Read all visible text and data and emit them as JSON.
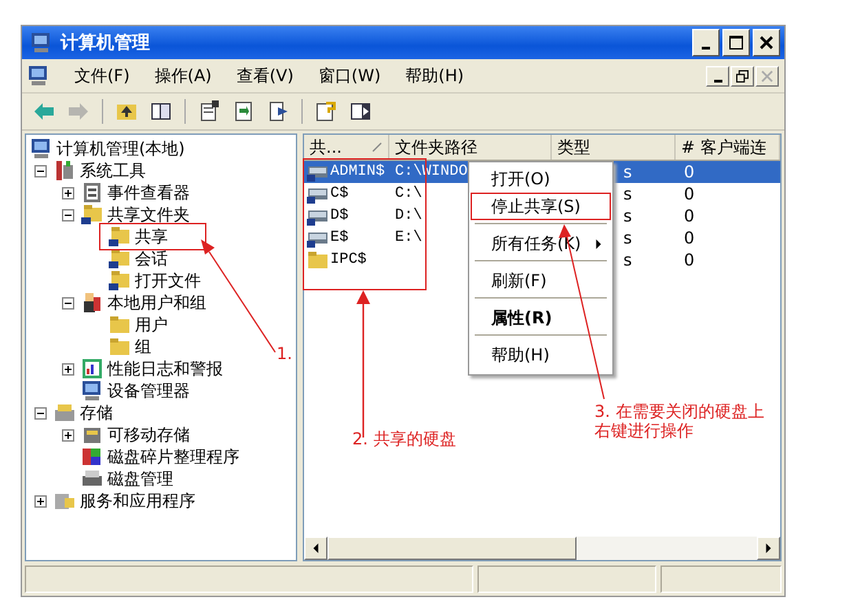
{
  "window": {
    "title": "计算机管理"
  },
  "menu_bar": [
    {
      "label": "文件(F)"
    },
    {
      "label": "操作(A)"
    },
    {
      "label": "查看(V)"
    },
    {
      "label": "窗口(W)"
    },
    {
      "label": "帮助(H)"
    }
  ],
  "toolbar": [
    {
      "kind": "back",
      "disabled": false
    },
    {
      "kind": "forward",
      "disabled": true
    },
    {
      "kind": "separator"
    },
    {
      "kind": "up",
      "disabled": false
    },
    {
      "kind": "tree",
      "disabled": false
    },
    {
      "kind": "separator"
    },
    {
      "kind": "properties",
      "disabled": false
    },
    {
      "kind": "refresh",
      "disabled": false
    },
    {
      "kind": "export",
      "disabled": false
    },
    {
      "kind": "separator"
    },
    {
      "kind": "help",
      "disabled": false
    },
    {
      "kind": "panel",
      "disabled": false
    }
  ],
  "tree": [
    {
      "label": "计算机管理(本地)",
      "kind": "computer",
      "children": [
        {
          "label": "系统工具",
          "kind": "tools",
          "expanded": true,
          "children": [
            {
              "label": "事件查看器",
              "kind": "event",
              "expanded": false
            },
            {
              "label": "共享文件夹",
              "kind": "share",
              "expanded": true,
              "children": [
                {
                  "label": "共享",
                  "kind": "share"
                },
                {
                  "label": "会话",
                  "kind": "share"
                },
                {
                  "label": "打开文件",
                  "kind": "share"
                }
              ]
            },
            {
              "label": "本地用户和组",
              "kind": "users",
              "expanded": true,
              "children": [
                {
                  "label": "用户",
                  "kind": "folder"
                },
                {
                  "label": "组",
                  "kind": "folder"
                }
              ]
            },
            {
              "label": "性能日志和警报",
              "kind": "perf",
              "expanded": false
            },
            {
              "label": "设备管理器",
              "kind": "computer"
            }
          ]
        },
        {
          "label": "存储",
          "kind": "storage",
          "expanded": true,
          "children": [
            {
              "label": "可移动存储",
              "kind": "removable",
              "expanded": false
            },
            {
              "label": "磁盘碎片整理程序",
              "kind": "defrag"
            },
            {
              "label": "磁盘管理",
              "kind": "disk"
            }
          ]
        },
        {
          "label": "服务和应用程序",
          "kind": "services",
          "expanded": false
        }
      ]
    }
  ],
  "table": {
    "columns": [
      "共...",
      "文件夹路径",
      "类型",
      "# 客户端连"
    ],
    "rows": [
      {
        "kind": "drive",
        "name": "ADMIN$",
        "path": "C:\\WINDO",
        "type": "s",
        "clients": "0",
        "selected": true
      },
      {
        "kind": "drive",
        "name": "C$",
        "path": "C:\\",
        "type": "s",
        "clients": "0",
        "selected": false
      },
      {
        "kind": "drive",
        "name": "D$",
        "path": "D:\\",
        "type": "s",
        "clients": "0",
        "selected": false
      },
      {
        "kind": "drive",
        "name": "E$",
        "path": "E:\\",
        "type": "s",
        "clients": "0",
        "selected": false
      },
      {
        "kind": "folder",
        "name": "IPC$",
        "type": "s",
        "clients": "0",
        "selected": false
      }
    ]
  },
  "context_menu": [
    {
      "kind": "item",
      "label": "打开(O)",
      "default": false,
      "submenu": false,
      "marked": false
    },
    {
      "kind": "item",
      "label": "停止共享(S)",
      "default": false,
      "submenu": false,
      "marked": true
    },
    {
      "kind": "separator"
    },
    {
      "kind": "item",
      "label": "所有任务(K)",
      "default": false,
      "submenu": true,
      "marked": false
    },
    {
      "kind": "separator"
    },
    {
      "kind": "item",
      "label": "刷新(F)",
      "default": false,
      "submenu": false,
      "marked": false
    },
    {
      "kind": "separator"
    },
    {
      "kind": "item",
      "label": "属性(R)",
      "default": true,
      "submenu": false,
      "marked": false
    },
    {
      "kind": "separator"
    },
    {
      "kind": "item",
      "label": "帮助(H)",
      "default": false,
      "submenu": false,
      "marked": false
    }
  ],
  "annotations": [
    {
      "text": "1."
    },
    {
      "text": "2. 共享的硬盘"
    },
    {
      "text": "3. 在需要关闭的硬盘上右键进行操作"
    }
  ]
}
